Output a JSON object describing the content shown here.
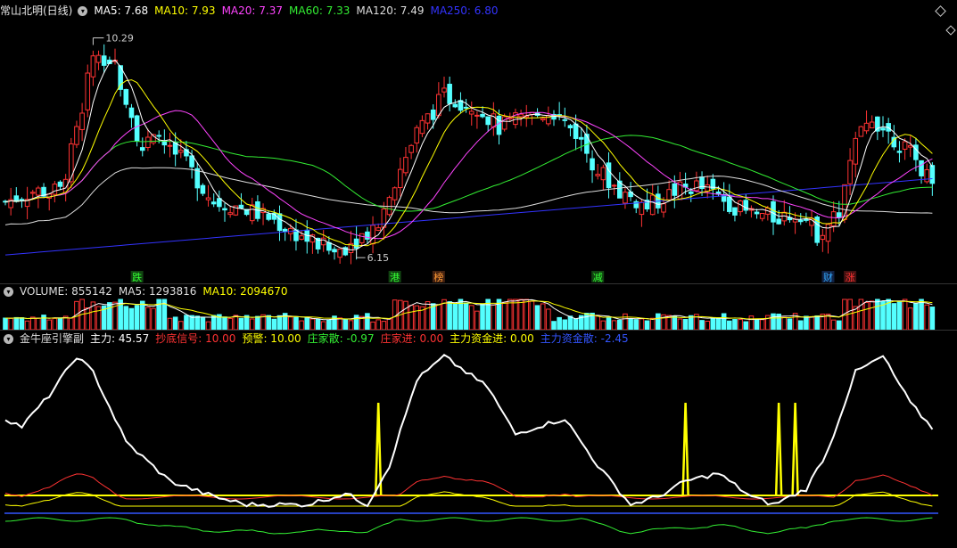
{
  "main": {
    "title": "常山北明(日线)",
    "ma": [
      {
        "label": "MA5: 7.68",
        "color": "#ffffff"
      },
      {
        "label": "MA10: 7.93",
        "color": "#ffff00"
      },
      {
        "label": "MA20: 7.37",
        "color": "#ff44ff"
      },
      {
        "label": "MA60: 7.33",
        "color": "#33ee33"
      },
      {
        "label": "MA120: 7.49",
        "color": "#dddddd"
      },
      {
        "label": "MA250: 6.80",
        "color": "#3333ff"
      }
    ],
    "high_label": "10.29",
    "low_label": "6.15",
    "markers": [
      {
        "text": "跌",
        "color": "#33ff33",
        "bg": "#114411",
        "idx": 24
      },
      {
        "text": "港",
        "color": "#33ff33",
        "bg": "#114411",
        "idx": 71
      },
      {
        "text": "榜",
        "color": "#ff9933",
        "bg": "#442211",
        "idx": 79
      },
      {
        "text": "减",
        "color": "#33ff33",
        "bg": "#114411",
        "idx": 108
      },
      {
        "text": "财",
        "color": "#33aaff",
        "bg": "#112244",
        "idx": 150
      },
      {
        "text": "涨",
        "color": "#ff3333",
        "bg": "#441111",
        "idx": 154
      }
    ]
  },
  "volume": {
    "label": "VOLUME: 855142",
    "ma5": "MA5: 1293816",
    "ma10": "MA10: 2094670"
  },
  "indicator": {
    "name": "金牛座引擎副",
    "items": [
      {
        "label": "主力: 45.57",
        "color": "#ffffff"
      },
      {
        "label": "抄底信号: 10.00",
        "color": "#ff3333"
      },
      {
        "label": "预警: 10.00",
        "color": "#ffff00"
      },
      {
        "label": "庄家散: -0.97",
        "color": "#33ee33"
      },
      {
        "label": "庄家进: 0.00",
        "color": "#ff3333"
      },
      {
        "label": "主力资金进: 0.00",
        "color": "#ffff00"
      },
      {
        "label": "主力资金散: -2.45",
        "color": "#3355ff"
      }
    ]
  },
  "colors": {
    "up": "#ff3333",
    "down": "#54ffff"
  },
  "chart_data": {
    "type": "candlestick",
    "close_key": [
      [
        0,
        7.2
      ],
      [
        5,
        7.4
      ],
      [
        10,
        7.4
      ],
      [
        13,
        8.5
      ],
      [
        16,
        10.0
      ],
      [
        18,
        9.6
      ],
      [
        20,
        9.8
      ],
      [
        25,
        8.2
      ],
      [
        28,
        8.4
      ],
      [
        33,
        7.9
      ],
      [
        38,
        7.2
      ],
      [
        43,
        7.1
      ],
      [
        48,
        6.9
      ],
      [
        53,
        6.6
      ],
      [
        57,
        6.4
      ],
      [
        60,
        6.25
      ],
      [
        64,
        6.5
      ],
      [
        68,
        6.8
      ],
      [
        71,
        7.6
      ],
      [
        75,
        8.5
      ],
      [
        80,
        9.2
      ],
      [
        86,
        9.0
      ],
      [
        90,
        8.6
      ],
      [
        95,
        8.8
      ],
      [
        100,
        8.9
      ],
      [
        104,
        8.5
      ],
      [
        108,
        7.8
      ],
      [
        112,
        7.4
      ],
      [
        117,
        7.1
      ],
      [
        122,
        7.4
      ],
      [
        126,
        7.5
      ],
      [
        130,
        7.3
      ],
      [
        135,
        7.0
      ],
      [
        140,
        6.9
      ],
      [
        145,
        7.0
      ],
      [
        148,
        6.6
      ],
      [
        152,
        7.0
      ],
      [
        155,
        8.3
      ],
      [
        158,
        8.8
      ],
      [
        161,
        8.5
      ],
      [
        165,
        8.1
      ],
      [
        168,
        7.7
      ]
    ],
    "y_range": [
      6.0,
      10.6
    ],
    "high": 10.29,
    "low": 6.15
  }
}
